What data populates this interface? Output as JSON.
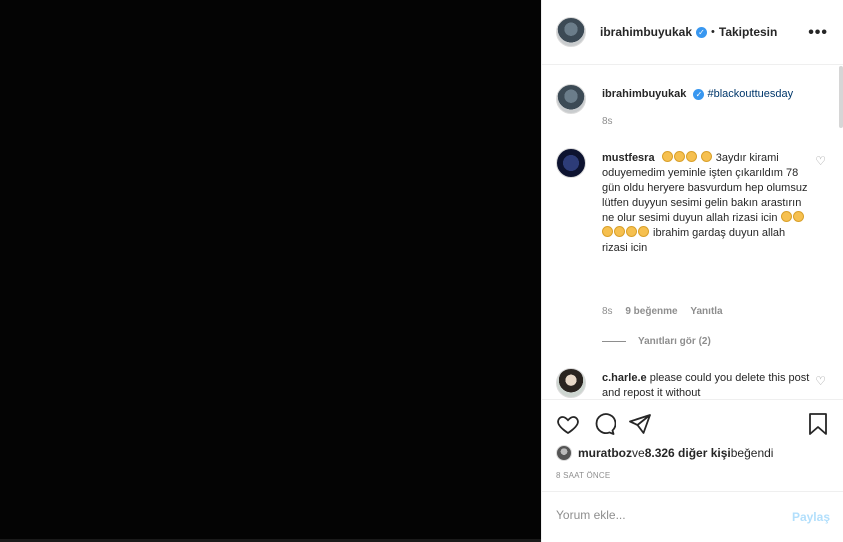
{
  "post": {
    "username": "ibrahimbuyukak",
    "follow_label": "Takiptesin",
    "separator": "•",
    "more_label": "•••"
  },
  "caption": {
    "username": "ibrahimbuyukak",
    "hashtag": "#blackouttuesday",
    "time": "8s"
  },
  "comments": [
    {
      "username": "mustfesra",
      "text_part1": " 3aydır kirami oduyemedim yeminle işten çıkarıldım 78 gün oldu heryere basvurdum hep olumsuz lütfen duyyun sesimi gelin bakın arastırın ne olur sesimi duyun allah rizasi icin ",
      "text_part2": " ibrahim gardaş duyun allah rizasi icin",
      "time": "8s",
      "likes": "9 beğenme",
      "reply": "Yanıtla",
      "view_replies": "Yanıtları gör (2)"
    },
    {
      "username": "c.harle.e",
      "text": " please could you delete this post and repost it without"
    }
  ],
  "likes": {
    "liker": "muratboz",
    "conj": " ve ",
    "others": "8.326 diğer kişi",
    "suffix": " beğendi"
  },
  "timestamp": "8 SAAT ÖNCE",
  "add_comment": {
    "placeholder": "Yorum ekle...",
    "post_label": "Paylaş"
  },
  "icons": [
    "heart-icon",
    "comment-icon",
    "share-icon",
    "bookmark-icon",
    "verified-icon",
    "more-icon"
  ]
}
